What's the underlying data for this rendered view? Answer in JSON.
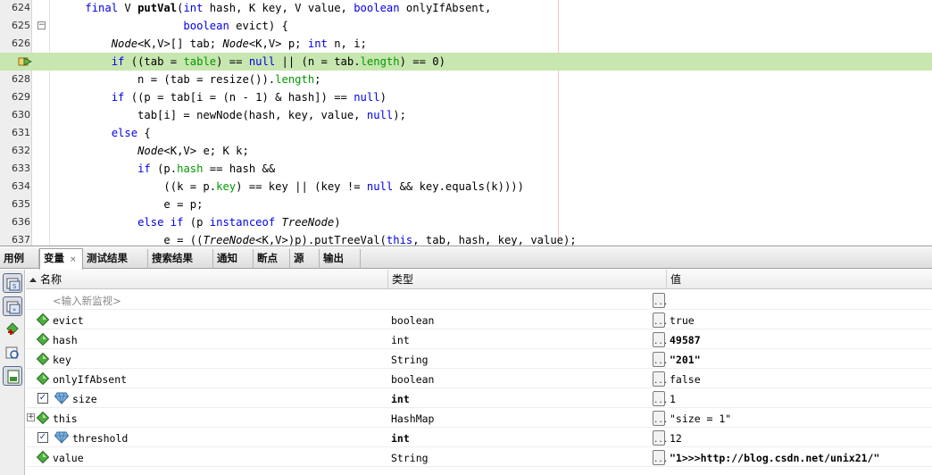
{
  "editor": {
    "lines": [
      {
        "num": "624",
        "segments": [
          [
            "",
            "    "
          ],
          [
            "kw",
            "final"
          ],
          [
            "",
            " V "
          ],
          [
            "mth",
            "putVal"
          ],
          [
            "",
            "("
          ],
          [
            "kw",
            "int"
          ],
          [
            "",
            " hash, K key, V value, "
          ],
          [
            "kw",
            "boolean"
          ],
          [
            "",
            " onlyIfAbsent,"
          ]
        ]
      },
      {
        "num": "625",
        "fold": true,
        "segments": [
          [
            "",
            "                   "
          ],
          [
            "kw",
            "boolean"
          ],
          [
            "",
            " evict) {"
          ]
        ]
      },
      {
        "num": "626",
        "segments": [
          [
            "",
            "        "
          ],
          [
            "typ",
            "Node"
          ],
          [
            "",
            "<K,V>[] tab; "
          ],
          [
            "typ",
            "Node"
          ],
          [
            "",
            "<K,V> p; "
          ],
          [
            "kw",
            "int"
          ],
          [
            "",
            " n, i;"
          ]
        ]
      },
      {
        "num": "",
        "current": true,
        "segments": [
          [
            "",
            "        "
          ],
          [
            "kw",
            "if"
          ],
          [
            "",
            " ((tab = "
          ],
          [
            "fld",
            "table"
          ],
          [
            "",
            ") == "
          ],
          [
            "kw",
            "null"
          ],
          [
            "",
            " || (n = tab."
          ],
          [
            "fld",
            "length"
          ],
          [
            "",
            ") == 0)"
          ]
        ]
      },
      {
        "num": "628",
        "segments": [
          [
            "",
            "            n = (tab = resize())."
          ],
          [
            "fld",
            "length"
          ],
          [
            "",
            ";"
          ]
        ]
      },
      {
        "num": "629",
        "segments": [
          [
            "",
            "        "
          ],
          [
            "kw",
            "if"
          ],
          [
            "",
            " ((p = tab[i = (n - 1) & hash]) == "
          ],
          [
            "kw",
            "null"
          ],
          [
            "",
            ")"
          ]
        ]
      },
      {
        "num": "630",
        "segments": [
          [
            "",
            "            tab[i] = newNode(hash, key, value, "
          ],
          [
            "kw",
            "null"
          ],
          [
            "",
            ");"
          ]
        ]
      },
      {
        "num": "631",
        "segments": [
          [
            "",
            "        "
          ],
          [
            "kw",
            "else"
          ],
          [
            "",
            " {"
          ]
        ]
      },
      {
        "num": "632",
        "segments": [
          [
            "",
            "            "
          ],
          [
            "typ",
            "Node"
          ],
          [
            "",
            "<K,V> e; K k;"
          ]
        ]
      },
      {
        "num": "633",
        "segments": [
          [
            "",
            "            "
          ],
          [
            "kw",
            "if"
          ],
          [
            "",
            " (p."
          ],
          [
            "fld",
            "hash"
          ],
          [
            "",
            " == hash &&"
          ]
        ]
      },
      {
        "num": "634",
        "segments": [
          [
            "",
            "                ((k = p."
          ],
          [
            "fld",
            "key"
          ],
          [
            "",
            ") == key || (key != "
          ],
          [
            "kw",
            "null"
          ],
          [
            "",
            " && key.equals(k))))"
          ]
        ]
      },
      {
        "num": "635",
        "segments": [
          [
            "",
            "                e = p;"
          ]
        ]
      },
      {
        "num": "636",
        "segments": [
          [
            "",
            "            "
          ],
          [
            "kw",
            "else if"
          ],
          [
            "",
            " (p "
          ],
          [
            "kw",
            "instanceof"
          ],
          [
            "",
            " "
          ],
          [
            "typ",
            "TreeNode"
          ],
          [
            "",
            ")"
          ]
        ]
      },
      {
        "num": "637",
        "segments": [
          [
            "",
            "                e = (("
          ],
          [
            "typ",
            "TreeNode"
          ],
          [
            "",
            "<K,V>)p).putTreeVal("
          ],
          [
            "kw",
            "this"
          ],
          [
            "",
            ", tab, hash, key, value);"
          ]
        ]
      }
    ]
  },
  "tabs": [
    {
      "label": "用例",
      "active": false
    },
    {
      "label": "变量",
      "active": true
    },
    {
      "label": "测试结果",
      "active": false
    },
    {
      "label": "搜索结果",
      "active": false
    },
    {
      "label": "通知",
      "active": false
    },
    {
      "label": "断点",
      "active": false
    },
    {
      "label": "源",
      "active": false
    },
    {
      "label": "输出",
      "active": false
    }
  ],
  "tab_close_glyph": "×",
  "variables": {
    "columns": {
      "name": "名称",
      "type": "类型",
      "value": "值"
    },
    "new_watch_placeholder": "<输入新监视>",
    "ellipsis": "...",
    "rows": [
      {
        "kind": "local",
        "name": "evict",
        "type": "boolean",
        "value": "true",
        "bold": false
      },
      {
        "kind": "local",
        "name": "hash",
        "type": "int",
        "value": "49587",
        "bold": true
      },
      {
        "kind": "local",
        "name": "key",
        "type": "String",
        "value": "\"201\"",
        "bold": true
      },
      {
        "kind": "local",
        "name": "onlyIfAbsent",
        "type": "boolean",
        "value": "false",
        "bold": false
      },
      {
        "kind": "field",
        "name": "size",
        "type": "int",
        "value": "1",
        "bold": false,
        "type_bold": true
      },
      {
        "kind": "this",
        "name": "this",
        "type": "HashMap",
        "value": "\"size = 1\"",
        "bold": false
      },
      {
        "kind": "field",
        "name": "threshold",
        "type": "int",
        "value": "12",
        "bold": false,
        "type_bold": true
      },
      {
        "kind": "local",
        "name": "value",
        "type": "String",
        "value": "\"1>>>http://blog.csdn.net/unix21/\"",
        "bold": true
      }
    ]
  },
  "colors": {
    "current_line": "#c8e6b0",
    "keyword": "#0000e6",
    "field": "#009900",
    "local_var_icon": "#4caf3f",
    "field_icon": "#7fb3e0"
  }
}
